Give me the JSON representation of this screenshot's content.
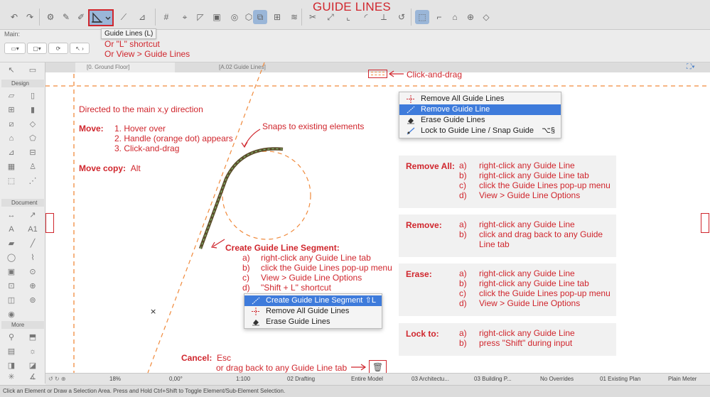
{
  "title": "GUIDE LINES",
  "toolbar": {
    "guide_lines_tooltip": "Guide Lines (L)",
    "main_label": "Main:"
  },
  "shortcut_note": [
    "Or \"L\" shortcut",
    "Or View > Guide Lines"
  ],
  "tabs": [
    "[0. Ground Floor]",
    "[A.02 Guide Lines]"
  ],
  "palette": {
    "design_head": "Design",
    "document_head": "Document",
    "more_head": "More"
  },
  "drag_note": "Click-and-drag",
  "canvas_notes": {
    "directed": "Directed to the main x,y direction",
    "move_label": "Move:",
    "move_steps": [
      "1. Hover over",
      "2. Handle (orange dot) appears",
      "3. Click-and-drag"
    ],
    "move_copy_label": "Move copy:",
    "move_copy_value": "Alt",
    "snaps": "Snaps to existing elements",
    "segment_title": "Create Guide Line Segment:",
    "segment_steps": [
      {
        "k": "a)",
        "v": "right-click any Guide Line tab"
      },
      {
        "k": "b)",
        "v": "click the Guide Lines pop-up menu"
      },
      {
        "k": "c)",
        "v": "View > Guide Line Options"
      },
      {
        "k": "d)",
        "v": "\"Shift + L\" shortcut"
      }
    ],
    "cancel_label": "Cancel:",
    "cancel_value": "Esc",
    "cancel_alt": "or drag back to any Guide Line tab"
  },
  "top_menu": {
    "items": [
      {
        "label": "Remove All Guide Lines",
        "shortcut": "",
        "icon": "remove-all-icon"
      },
      {
        "label": "Remove Guide Line",
        "shortcut": "",
        "icon": "remove-one-icon"
      },
      {
        "label": "Erase Guide Lines",
        "shortcut": "",
        "icon": "eraser-icon"
      },
      {
        "label": "Lock to Guide Line / Snap Guide",
        "shortcut": "⌥§",
        "icon": "lock-icon"
      }
    ]
  },
  "bottom_menu": {
    "items": [
      {
        "label": "Create Guide Line Segment",
        "shortcut": "⇧L",
        "icon": "segment-icon"
      },
      {
        "label": "Remove All Guide Lines",
        "shortcut": "",
        "icon": "remove-all-icon"
      },
      {
        "label": "Erase Guide Lines",
        "shortcut": "",
        "icon": "eraser-icon"
      }
    ]
  },
  "boxes": [
    {
      "label": "Remove All:",
      "rows": [
        {
          "k": "a)",
          "v": "right-click any Guide Line"
        },
        {
          "k": "b)",
          "v": "right-click any Guide Line tab"
        },
        {
          "k": "c)",
          "v": "click the Guide Lines pop-up menu"
        },
        {
          "k": "d)",
          "v": "View > Guide Line Options"
        }
      ]
    },
    {
      "label": "Remove:",
      "rows": [
        {
          "k": "a)",
          "v": "right-click any Guide Line"
        },
        {
          "k": "b)",
          "v": "click and drag back to any Guide Line tab"
        }
      ]
    },
    {
      "label": "Erase:",
      "rows": [
        {
          "k": "a)",
          "v": "right-click any Guide Line"
        },
        {
          "k": "b)",
          "v": "right-click any Guide Line tab"
        },
        {
          "k": "c)",
          "v": "click the Guide Lines pop-up menu"
        },
        {
          "k": "d)",
          "v": "View > Guide Line Options"
        }
      ]
    },
    {
      "label": "Lock to:",
      "rows": [
        {
          "k": "a)",
          "v": "right-click any Guide Line"
        },
        {
          "k": "b)",
          "v": "press \"Shift\" during input"
        }
      ]
    }
  ],
  "statusbar": {
    "zoom": "18%",
    "angle": "0,00°",
    "scale": "1:100",
    "layer": "02 Drafting",
    "model": "Entire Model",
    "view": "03 Architectu...",
    "building": "03 Building P...",
    "override": "No Overrides",
    "plan": "01 Existing Plan",
    "meter": "Plain Meter"
  },
  "hint": "Click an Element or Draw a Selection Area. Press and Hold Ctrl+Shift to Toggle Element/Sub-Element Selection.",
  "colors": {
    "accent": "#d0262d",
    "guide": "#f08a3c",
    "highlight": "#3e7bdb"
  }
}
